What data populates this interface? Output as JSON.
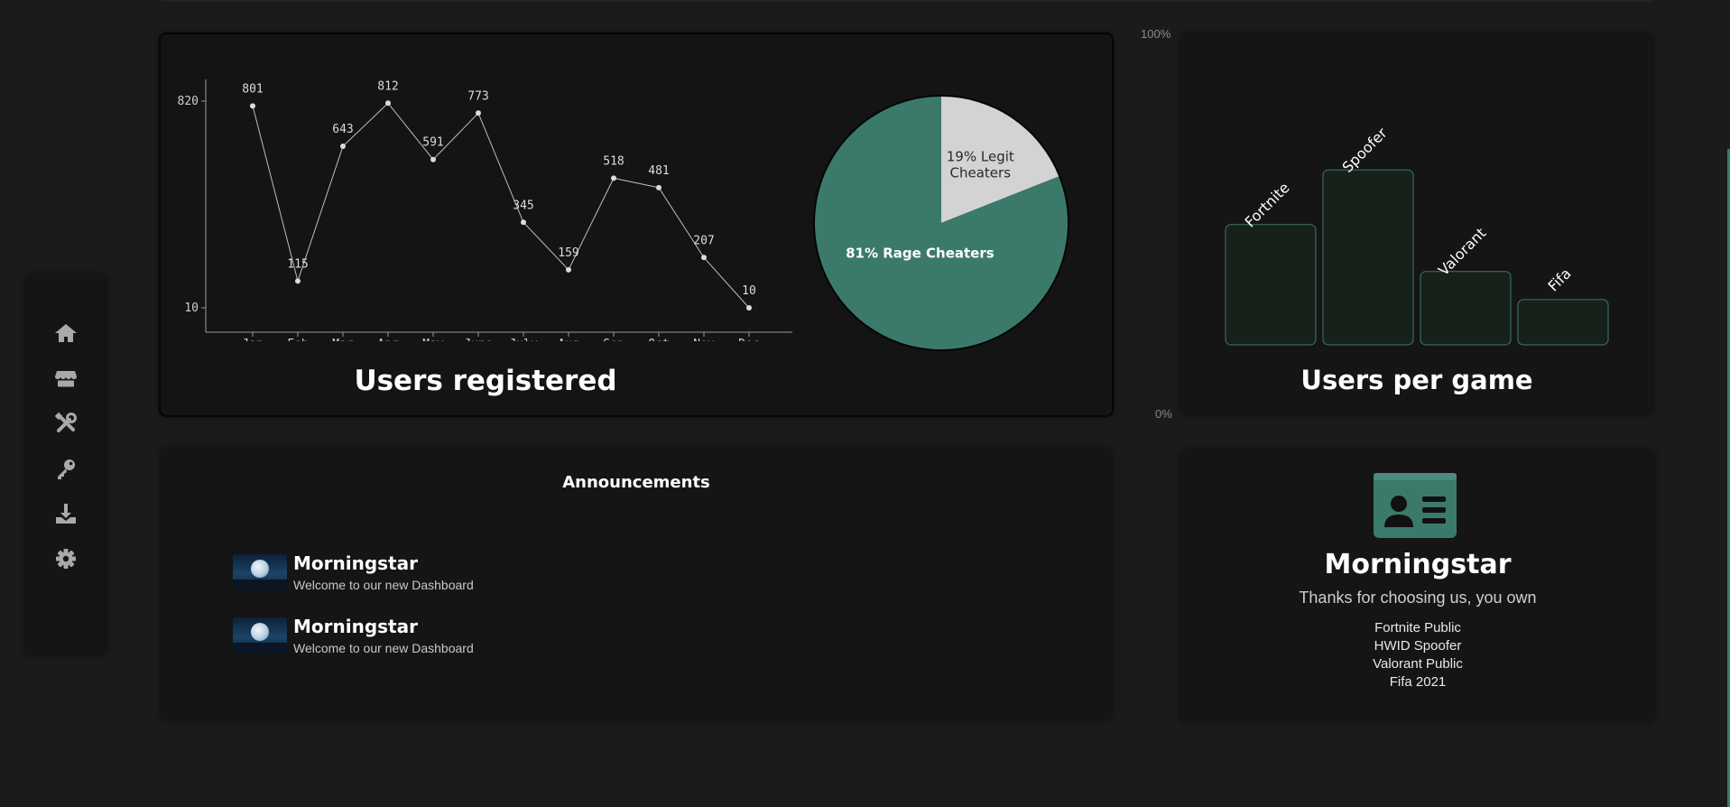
{
  "nav": {
    "items": [
      {
        "icon": "home-icon"
      },
      {
        "icon": "store-icon"
      },
      {
        "icon": "tools-icon"
      },
      {
        "icon": "key-icon"
      },
      {
        "icon": "download-icon"
      },
      {
        "icon": "gear-icon"
      }
    ]
  },
  "colors": {
    "background": "#1b1b1b",
    "card": "#151515",
    "accent": "#3b7a6b",
    "pie_light": "#d3d3d3"
  },
  "users_registered": {
    "title": "Users registered"
  },
  "users_per_game": {
    "title": "Users per game",
    "axis_top": "100%",
    "axis_bottom": "0%"
  },
  "announcements": {
    "title": "Announcements",
    "items": [
      {
        "name": "Morningstar",
        "message": "Welcome to our new Dashboard"
      },
      {
        "name": "Morningstar",
        "message": "Welcome to our new Dashboard"
      }
    ]
  },
  "profile": {
    "icon": "id-card-icon",
    "name": "Morningstar",
    "thanks": "Thanks for choosing us, you own",
    "products": [
      "Fortnite Public",
      "HWID Spoofer",
      "Valorant Public",
      "Fifa 2021"
    ]
  },
  "chart_data": [
    {
      "type": "line",
      "categories": [
        "Jan",
        "Feb",
        "Mar",
        "Apr",
        "May",
        "June",
        "July",
        "Aug",
        "Sep",
        "Oct",
        "Nov",
        "Dec"
      ],
      "values": [
        801,
        115,
        643,
        812,
        591,
        773,
        345,
        159,
        518,
        481,
        207,
        10
      ],
      "y_ticks": [
        "820",
        "10"
      ],
      "ylim": [
        10,
        820
      ],
      "grid": false
    },
    {
      "type": "pie",
      "slices": [
        {
          "label": "19% Legit Cheaters",
          "value": 19,
          "color": "#d3d3d3"
        },
        {
          "label": "81% Rage Cheaters",
          "value": 81,
          "color": "#3b7a6b"
        }
      ]
    },
    {
      "type": "bar",
      "categories": [
        "Fortnite",
        "Spoofer",
        "Valorant",
        "Fifa"
      ],
      "values": [
        38.5,
        56,
        23.5,
        14.5
      ],
      "ylim": [
        0,
        100
      ]
    }
  ]
}
